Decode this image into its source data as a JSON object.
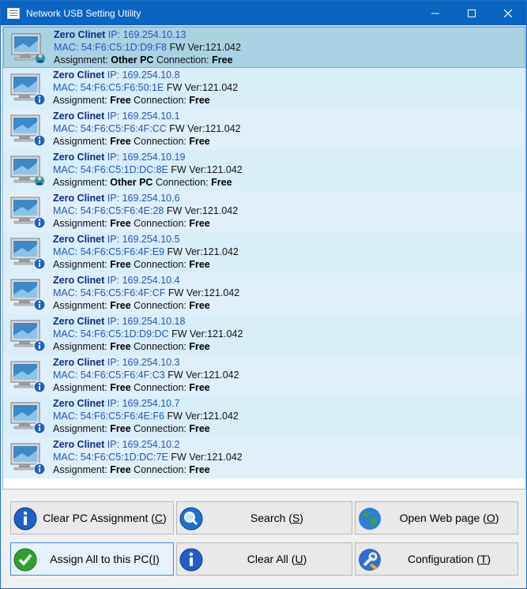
{
  "window": {
    "title": "Network USB Setting Utility"
  },
  "labels": {
    "ip": "IP:",
    "mac": "MAC:",
    "fw": "FW Ver:",
    "assignment": "Assignment:",
    "connection": "Connection:"
  },
  "clients": [
    {
      "name": "Zero Clinet",
      "ip": "169.254.10.13",
      "mac": "54:F6:C5:1D:D9:F8",
      "fw": "121.042",
      "assignment": "Other PC",
      "connection": "Free",
      "icon": "pc-user-icon",
      "selected": true
    },
    {
      "name": "Zero Clinet",
      "ip": "169.254.10.8",
      "mac": "54:F6:C5:F6:50:1E",
      "fw": "121.042",
      "assignment": "Free",
      "connection": "Free",
      "icon": "pc-info-icon"
    },
    {
      "name": "Zero Clinet",
      "ip": "169.254.10.1",
      "mac": "54:F6:C5:F6:4F:CC",
      "fw": "121.042",
      "assignment": "Free",
      "connection": "Free",
      "icon": "pc-info-icon"
    },
    {
      "name": "Zero Clinet",
      "ip": "169.254.10.19",
      "mac": "54:F6:C5:1D:DC:8E",
      "fw": "121.042",
      "assignment": "Other PC",
      "connection": "Free",
      "icon": "pc-user-icon"
    },
    {
      "name": "Zero Clinet",
      "ip": "169.254.10.6",
      "mac": "54:F6:C5:F6:4E:28",
      "fw": "121.042",
      "assignment": "Free",
      "connection": "Free",
      "icon": "pc-info-icon"
    },
    {
      "name": "Zero Clinet",
      "ip": "169.254.10.5",
      "mac": "54:F6:C5:F6:4F:E9",
      "fw": "121.042",
      "assignment": "Free",
      "connection": "Free",
      "icon": "pc-info-icon"
    },
    {
      "name": "Zero Clinet",
      "ip": "169.254.10.4",
      "mac": "54:F6:C5:F6:4F:CF",
      "fw": "121.042",
      "assignment": "Free",
      "connection": "Free",
      "icon": "pc-info-icon"
    },
    {
      "name": "Zero Clinet",
      "ip": "169.254.10.18",
      "mac": "54:F6:C5:1D:D9:DC",
      "fw": "121.042",
      "assignment": "Free",
      "connection": "Free",
      "icon": "pc-info-icon"
    },
    {
      "name": "Zero Clinet",
      "ip": "169.254.10.3",
      "mac": "54:F6:C5:F6:4F:C3",
      "fw": "121.042",
      "assignment": "Free",
      "connection": "Free",
      "icon": "pc-info-icon"
    },
    {
      "name": "Zero Clinet",
      "ip": "169.254.10.7",
      "mac": "54:F6:C5:F6:4E:F6",
      "fw": "121.042",
      "assignment": "Free",
      "connection": "Free",
      "icon": "pc-info-icon"
    },
    {
      "name": "Zero Clinet",
      "ip": "169.254.10.2",
      "mac": "54:F6:C5:1D:DC:7E",
      "fw": "121.042",
      "assignment": "Free",
      "connection": "Free",
      "icon": "pc-info-icon"
    }
  ],
  "buttons": {
    "clear_pc": {
      "text": "Clear PC Assignment (",
      "key": "C",
      "end": ")",
      "icon": "info-icon"
    },
    "search": {
      "text": "Search (",
      "key": "S",
      "end": ")",
      "icon": "search-icon"
    },
    "open_web": {
      "text": "Open Web page (",
      "key": "O",
      "end": ")",
      "icon": "globe-icon"
    },
    "assign_all": {
      "text": "Assign All  to this PC(",
      "key": "I",
      "end": ")",
      "icon": "checkmark-icon"
    },
    "clear_all": {
      "text": "Clear All (",
      "key": "U",
      "end": ")",
      "icon": "info-icon"
    },
    "configuration": {
      "text": "Configuration (",
      "key": "T",
      "end": ")",
      "icon": "wrench-icon"
    }
  },
  "colors": {
    "titlebar": "#0a64c2",
    "row": "#dff0fb",
    "selected_row": "#a9d2e3",
    "name_text": "#0b2a8a",
    "ip_text": "#2054c8"
  }
}
